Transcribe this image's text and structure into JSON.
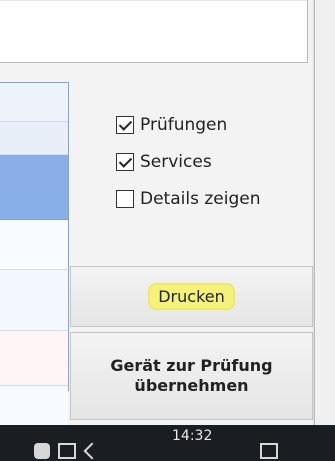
{
  "options": [
    {
      "label": "Prüfungen",
      "checked": true
    },
    {
      "label": "Services",
      "checked": true
    },
    {
      "label": "Details zeigen",
      "checked": false
    }
  ],
  "buttons": {
    "print": "Drucken",
    "take_over": "Gerät zur Prüfung\nübernehmen"
  },
  "taskbar": {
    "time": "14:32"
  }
}
